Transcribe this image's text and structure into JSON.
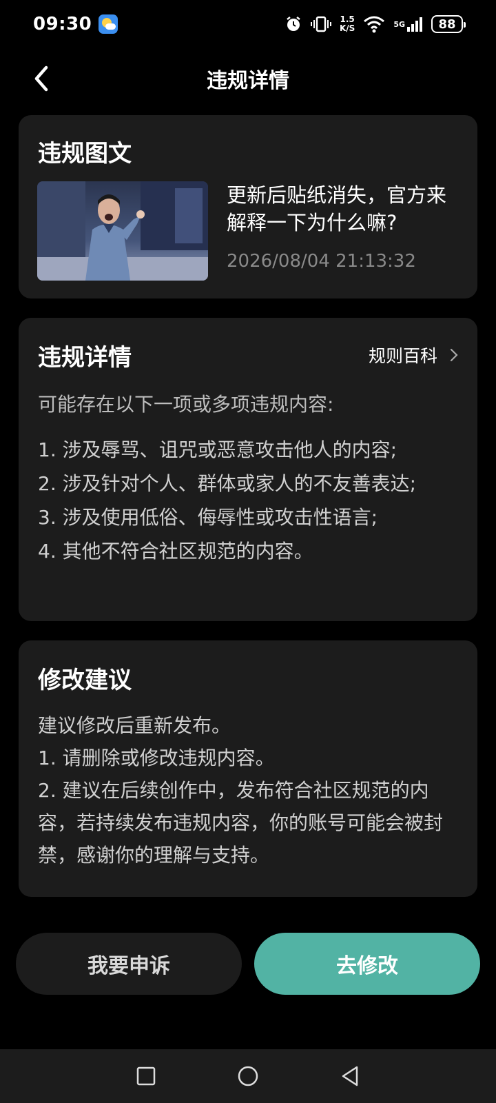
{
  "status_bar": {
    "time": "09:30",
    "net_speed_value": "1.5",
    "net_speed_unit": "K/S",
    "network": "5G",
    "battery": "88"
  },
  "header": {
    "title": "违规详情"
  },
  "violation_content": {
    "title": "违规图文",
    "post_title": "更新后贴纸消失，官方来解释一下为什么嘛?",
    "post_time": "2026/08/04 21:13:32"
  },
  "violation_detail": {
    "title": "违规详情",
    "rules_link": "规则百科",
    "intro": "可能存在以下一项或多项违规内容:",
    "items": [
      "1. 涉及辱骂、诅咒或恶意攻击他人的内容;",
      "2. 涉及针对个人、群体或家人的不友善表达;",
      "3. 涉及使用低俗、侮辱性或攻击性语言;",
      "4. 其他不符合社区规范的内容。"
    ]
  },
  "suggestion": {
    "title": "修改建议",
    "lines": [
      "建议修改后重新发布。",
      "1. 请删除或修改违规内容。",
      "2. 建议在后续创作中，发布符合社区规范的内容，若持续发布违规内容，你的账号可能会被封禁，感谢你的理解与支持。"
    ]
  },
  "actions": {
    "appeal_label": "我要申诉",
    "edit_label": "去修改"
  },
  "colors": {
    "accent": "#52b3a4",
    "card_bg": "#1c1c1c",
    "page_bg": "#000000"
  }
}
